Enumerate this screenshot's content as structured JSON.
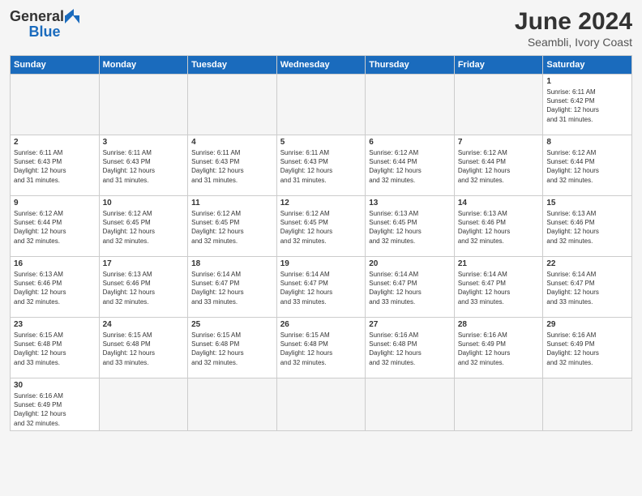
{
  "header": {
    "logo_text_general": "General",
    "logo_text_blue": "Blue",
    "month_year": "June 2024",
    "location": "Seambli, Ivory Coast"
  },
  "days_of_week": [
    "Sunday",
    "Monday",
    "Tuesday",
    "Wednesday",
    "Thursday",
    "Friday",
    "Saturday"
  ],
  "weeks": [
    [
      {
        "day": "",
        "empty": true
      },
      {
        "day": "",
        "empty": true
      },
      {
        "day": "",
        "empty": true
      },
      {
        "day": "",
        "empty": true
      },
      {
        "day": "",
        "empty": true
      },
      {
        "day": "",
        "empty": true
      },
      {
        "day": "1",
        "sunrise": "6:11 AM",
        "sunset": "6:42 PM",
        "daylight": "12 hours and 31 minutes."
      }
    ],
    [
      {
        "day": "2",
        "sunrise": "6:11 AM",
        "sunset": "6:43 PM",
        "daylight": "12 hours and 31 minutes."
      },
      {
        "day": "3",
        "sunrise": "6:11 AM",
        "sunset": "6:43 PM",
        "daylight": "12 hours and 31 minutes."
      },
      {
        "day": "4",
        "sunrise": "6:11 AM",
        "sunset": "6:43 PM",
        "daylight": "12 hours and 31 minutes."
      },
      {
        "day": "5",
        "sunrise": "6:11 AM",
        "sunset": "6:43 PM",
        "daylight": "12 hours and 31 minutes."
      },
      {
        "day": "6",
        "sunrise": "6:12 AM",
        "sunset": "6:44 PM",
        "daylight": "12 hours and 32 minutes."
      },
      {
        "day": "7",
        "sunrise": "6:12 AM",
        "sunset": "6:44 PM",
        "daylight": "12 hours and 32 minutes."
      },
      {
        "day": "8",
        "sunrise": "6:12 AM",
        "sunset": "6:44 PM",
        "daylight": "12 hours and 32 minutes."
      }
    ],
    [
      {
        "day": "9",
        "sunrise": "6:12 AM",
        "sunset": "6:44 PM",
        "daylight": "12 hours and 32 minutes."
      },
      {
        "day": "10",
        "sunrise": "6:12 AM",
        "sunset": "6:45 PM",
        "daylight": "12 hours and 32 minutes."
      },
      {
        "day": "11",
        "sunrise": "6:12 AM",
        "sunset": "6:45 PM",
        "daylight": "12 hours and 32 minutes."
      },
      {
        "day": "12",
        "sunrise": "6:12 AM",
        "sunset": "6:45 PM",
        "daylight": "12 hours and 32 minutes."
      },
      {
        "day": "13",
        "sunrise": "6:13 AM",
        "sunset": "6:45 PM",
        "daylight": "12 hours and 32 minutes."
      },
      {
        "day": "14",
        "sunrise": "6:13 AM",
        "sunset": "6:46 PM",
        "daylight": "12 hours and 32 minutes."
      },
      {
        "day": "15",
        "sunrise": "6:13 AM",
        "sunset": "6:46 PM",
        "daylight": "12 hours and 32 minutes."
      }
    ],
    [
      {
        "day": "16",
        "sunrise": "6:13 AM",
        "sunset": "6:46 PM",
        "daylight": "12 hours and 32 minutes."
      },
      {
        "day": "17",
        "sunrise": "6:13 AM",
        "sunset": "6:46 PM",
        "daylight": "12 hours and 32 minutes."
      },
      {
        "day": "18",
        "sunrise": "6:14 AM",
        "sunset": "6:47 PM",
        "daylight": "12 hours and 33 minutes."
      },
      {
        "day": "19",
        "sunrise": "6:14 AM",
        "sunset": "6:47 PM",
        "daylight": "12 hours and 33 minutes."
      },
      {
        "day": "20",
        "sunrise": "6:14 AM",
        "sunset": "6:47 PM",
        "daylight": "12 hours and 33 minutes."
      },
      {
        "day": "21",
        "sunrise": "6:14 AM",
        "sunset": "6:47 PM",
        "daylight": "12 hours and 33 minutes."
      },
      {
        "day": "22",
        "sunrise": "6:14 AM",
        "sunset": "6:47 PM",
        "daylight": "12 hours and 33 minutes."
      }
    ],
    [
      {
        "day": "23",
        "sunrise": "6:15 AM",
        "sunset": "6:48 PM",
        "daylight": "12 hours and 33 minutes."
      },
      {
        "day": "24",
        "sunrise": "6:15 AM",
        "sunset": "6:48 PM",
        "daylight": "12 hours and 33 minutes."
      },
      {
        "day": "25",
        "sunrise": "6:15 AM",
        "sunset": "6:48 PM",
        "daylight": "12 hours and 32 minutes."
      },
      {
        "day": "26",
        "sunrise": "6:15 AM",
        "sunset": "6:48 PM",
        "daylight": "12 hours and 32 minutes."
      },
      {
        "day": "27",
        "sunrise": "6:16 AM",
        "sunset": "6:48 PM",
        "daylight": "12 hours and 32 minutes."
      },
      {
        "day": "28",
        "sunrise": "6:16 AM",
        "sunset": "6:49 PM",
        "daylight": "12 hours and 32 minutes."
      },
      {
        "day": "29",
        "sunrise": "6:16 AM",
        "sunset": "6:49 PM",
        "daylight": "12 hours and 32 minutes."
      }
    ],
    [
      {
        "day": "30",
        "sunrise": "6:16 AM",
        "sunset": "6:49 PM",
        "daylight": "12 hours and 32 minutes."
      },
      {
        "day": "",
        "empty": true
      },
      {
        "day": "",
        "empty": true
      },
      {
        "day": "",
        "empty": true
      },
      {
        "day": "",
        "empty": true
      },
      {
        "day": "",
        "empty": true
      },
      {
        "day": "",
        "empty": true
      }
    ]
  ],
  "label_sunrise": "Sunrise:",
  "label_sunset": "Sunset:",
  "label_daylight": "Daylight:"
}
